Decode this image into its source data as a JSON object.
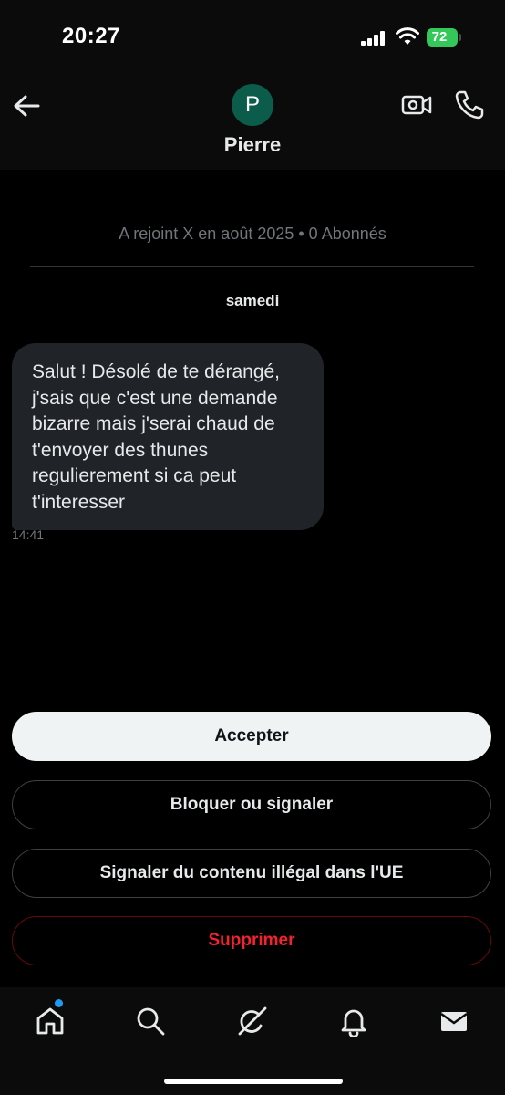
{
  "status_bar": {
    "time": "20:27",
    "battery": "72"
  },
  "header": {
    "avatar_letter": "P",
    "name": "Pierre"
  },
  "conversation": {
    "joined_info": "A rejoint X en août 2025 • 0 Abonnés",
    "day_label": "samedi",
    "messages": [
      {
        "text": "Salut ! Désolé de te dérangé, j'sais que c'est une demande bizarre mais j'serai chaud de t'envoyer des thunes regulierement si ca peut t'interesser",
        "time": "14:41"
      }
    ]
  },
  "actions": {
    "accept": "Accepter",
    "block": "Bloquer ou signaler",
    "report_eu": "Signaler du contenu illégal dans l'UE",
    "delete": "Supprimer"
  },
  "colors": {
    "accent": "#1d9bf0",
    "danger": "#f4212e",
    "avatar": "#0b5c4a",
    "battery": "#34c759"
  },
  "tabbar": {
    "icons": [
      "home-icon",
      "search-icon",
      "grok-icon",
      "bell-icon",
      "mail-icon"
    ],
    "home_has_dot": true
  }
}
